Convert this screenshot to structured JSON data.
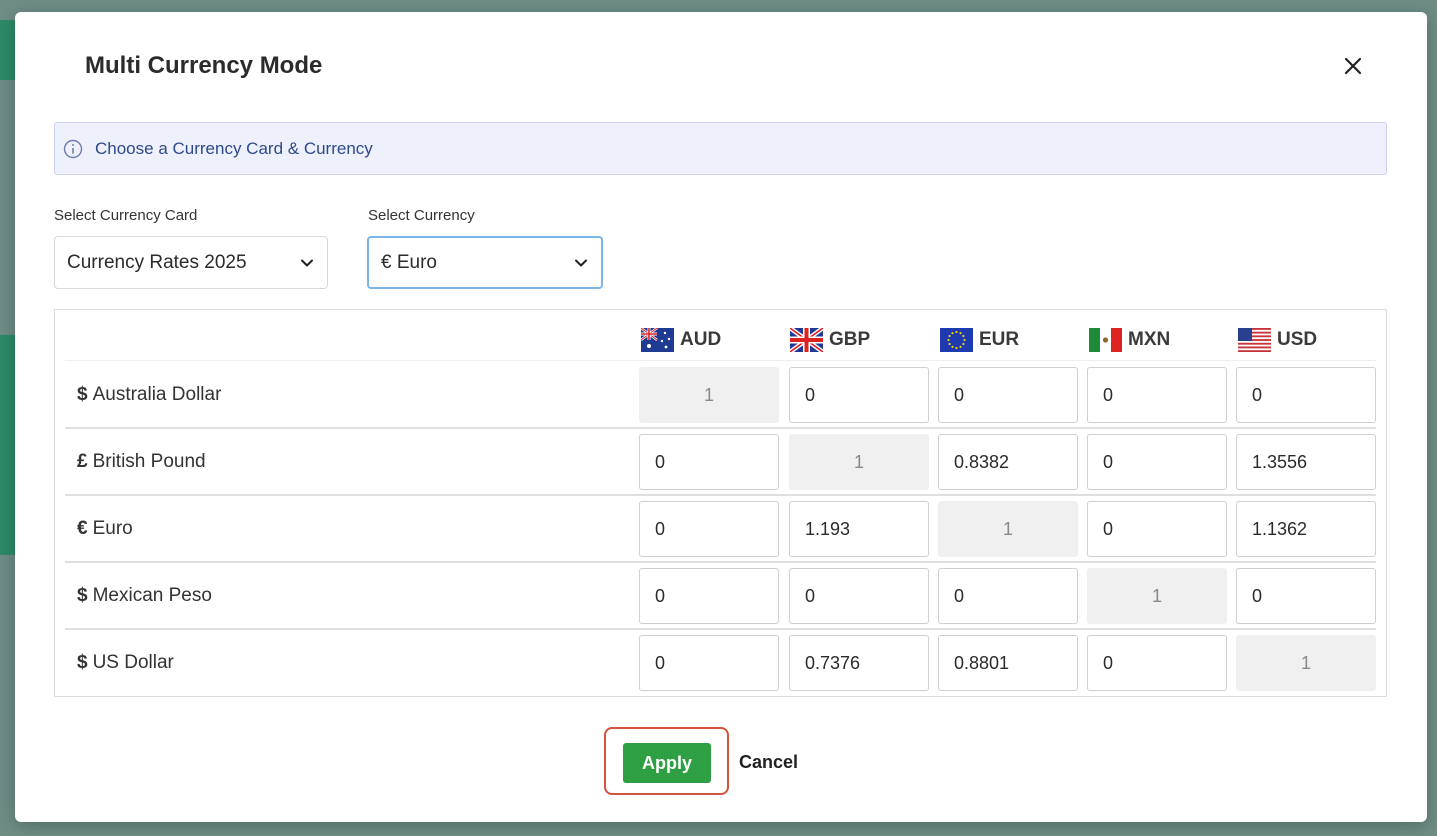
{
  "modal": {
    "title": "Multi Currency Mode",
    "info_text": "Choose a Currency Card & Currency"
  },
  "form": {
    "card_label": "Select Currency Card",
    "card_value": "Currency Rates 2025",
    "currency_label": "Select Currency",
    "currency_value": "€ Euro"
  },
  "grid": {
    "columns": [
      {
        "code": "AUD",
        "flag": "australia-flag-icon"
      },
      {
        "code": "GBP",
        "flag": "uk-flag-icon"
      },
      {
        "code": "EUR",
        "flag": "eu-flag-icon"
      },
      {
        "code": "MXN",
        "flag": "mexico-flag-icon"
      },
      {
        "code": "USD",
        "flag": "us-flag-icon"
      }
    ],
    "rows": [
      {
        "symbol": "$",
        "name": "Australia Dollar",
        "values": [
          "1",
          "0",
          "0",
          "0",
          "0"
        ]
      },
      {
        "symbol": "£",
        "name": "British Pound",
        "values": [
          "0",
          "1",
          "0.8382",
          "0",
          "1.3556"
        ]
      },
      {
        "symbol": "€",
        "name": "Euro",
        "values": [
          "0",
          "1.193",
          "1",
          "0",
          "1.1362"
        ]
      },
      {
        "symbol": "$",
        "name": "Mexican Peso",
        "values": [
          "0",
          "0",
          "0",
          "1",
          "0"
        ]
      },
      {
        "symbol": "$",
        "name": "US Dollar",
        "values": [
          "0",
          "0.7376",
          "0.8801",
          "0",
          "1"
        ]
      }
    ]
  },
  "footer": {
    "apply_label": "Apply",
    "cancel_label": "Cancel"
  },
  "colors": {
    "apply_green": "#2ea043",
    "highlight_outline": "#d4533c",
    "info_bg": "#eef1fb",
    "info_text": "#2e4a8a"
  }
}
